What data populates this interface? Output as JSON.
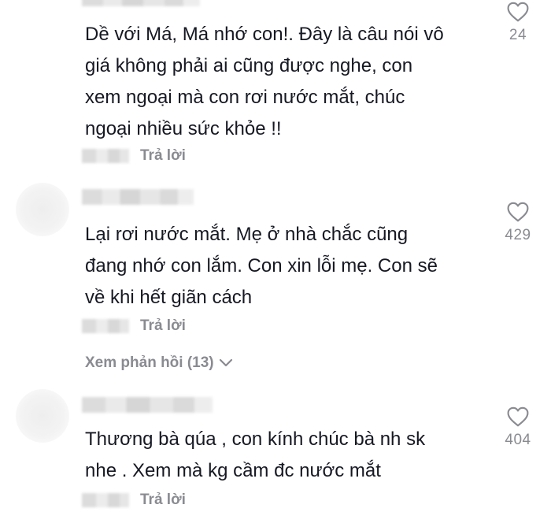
{
  "comments": [
    {
      "text_lines": [
        "Dề với Má, Má nhớ con!. Đây là câu nói vô",
        "giá không phải ai cũng được nghe, con",
        "xem ngoại mà con rơi nước mắt, chúc",
        "ngoại nhiều sức khỏe !!"
      ],
      "reply_label": "Trả lời",
      "like_count": "24",
      "like_icon": "heart-outline-icon"
    },
    {
      "text_lines": [
        "Lại rơi nước mắt. Mẹ ở nhà chắc cũng",
        "đang nhớ con lắm. Con xin lỗi mẹ. Con sẽ",
        "về khi hết giãn cách"
      ],
      "reply_label": "Trả lời",
      "like_count": "429",
      "like_icon": "heart-outline-icon",
      "view_replies": "Xem phản hồi (13)"
    },
    {
      "text_lines": [
        "Thương bà qúa , con kính chúc bà nh sk",
        "nhe . Xem mà kg cầm đc nước mắt"
      ],
      "reply_label": "Trả lời",
      "like_count": "404",
      "like_icon": "heart-outline-icon"
    }
  ]
}
